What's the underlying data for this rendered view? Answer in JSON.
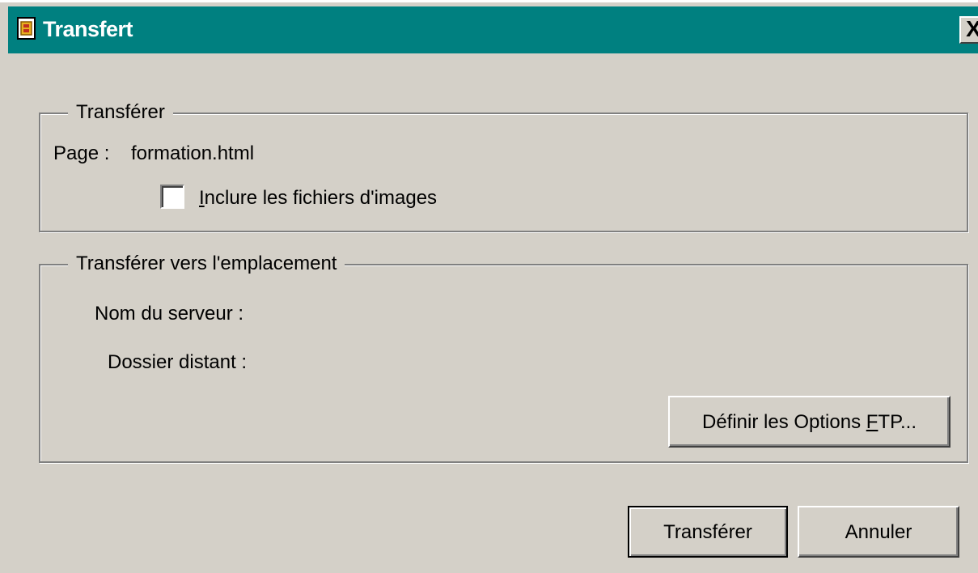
{
  "window": {
    "title": "Transfert",
    "close_label": "X"
  },
  "group_transfer": {
    "legend": "Transférer",
    "page_label": "Page :",
    "page_value": "formation.html",
    "include_images_accel": "I",
    "include_images_rest": "nclure les fichiers d'images",
    "include_images_checked": false
  },
  "group_location": {
    "legend": "Transférer vers l'emplacement",
    "server_label": "Nom du serveur :",
    "folder_label": "Dossier distant :",
    "ftp_button_prefix": "Définir les Options ",
    "ftp_button_accel": "F",
    "ftp_button_suffix": "TP..."
  },
  "buttons": {
    "transfer": "Transférer",
    "cancel": "Annuler"
  },
  "colors": {
    "titlebar": "#008080",
    "face": "#d4d0c8"
  }
}
